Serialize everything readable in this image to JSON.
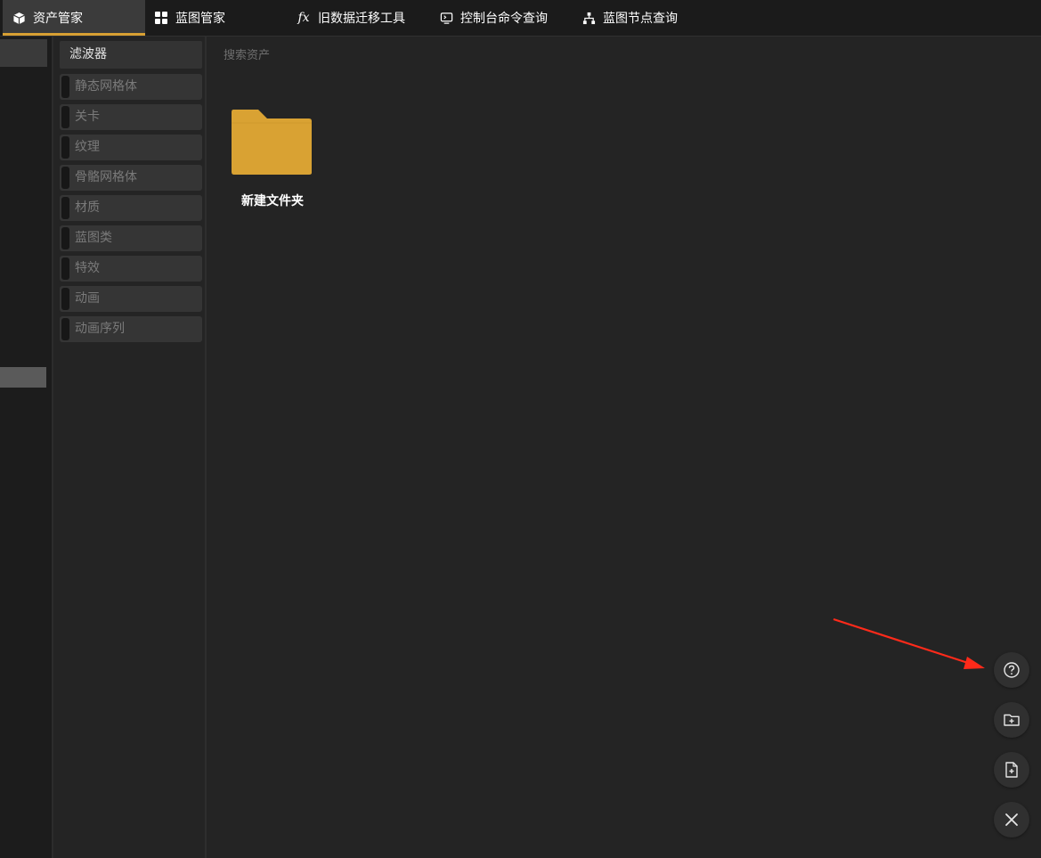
{
  "tabs": [
    {
      "label": "资产管家",
      "icon": "cube-icon",
      "active": true
    },
    {
      "label": "蓝图管家",
      "icon": "grid-icon",
      "active": false
    },
    {
      "label": "旧数据迁移工具",
      "icon": "function-icon",
      "active": false
    },
    {
      "label": "控制台命令查询",
      "icon": "console-icon",
      "active": false
    },
    {
      "label": "蓝图节点查询",
      "icon": "sitemap-icon",
      "active": false
    }
  ],
  "filters": {
    "header": "滤波器",
    "items": [
      "静态网格体",
      "关卡",
      "纹理",
      "骨骼网格体",
      "材质",
      "蓝图类",
      "特效",
      "动画",
      "动画序列"
    ]
  },
  "search": {
    "placeholder": "搜索资产"
  },
  "assets": [
    {
      "label": "新建文件夹",
      "icon": "folder-icon"
    }
  ],
  "fab_buttons": [
    "help-icon",
    "new-folder-icon",
    "new-file-icon",
    "close-icon"
  ],
  "colors": {
    "accent": "#d8a033",
    "folder": "#d9a233",
    "background": "#242424",
    "annotation_arrow": "#ff2a1a"
  }
}
